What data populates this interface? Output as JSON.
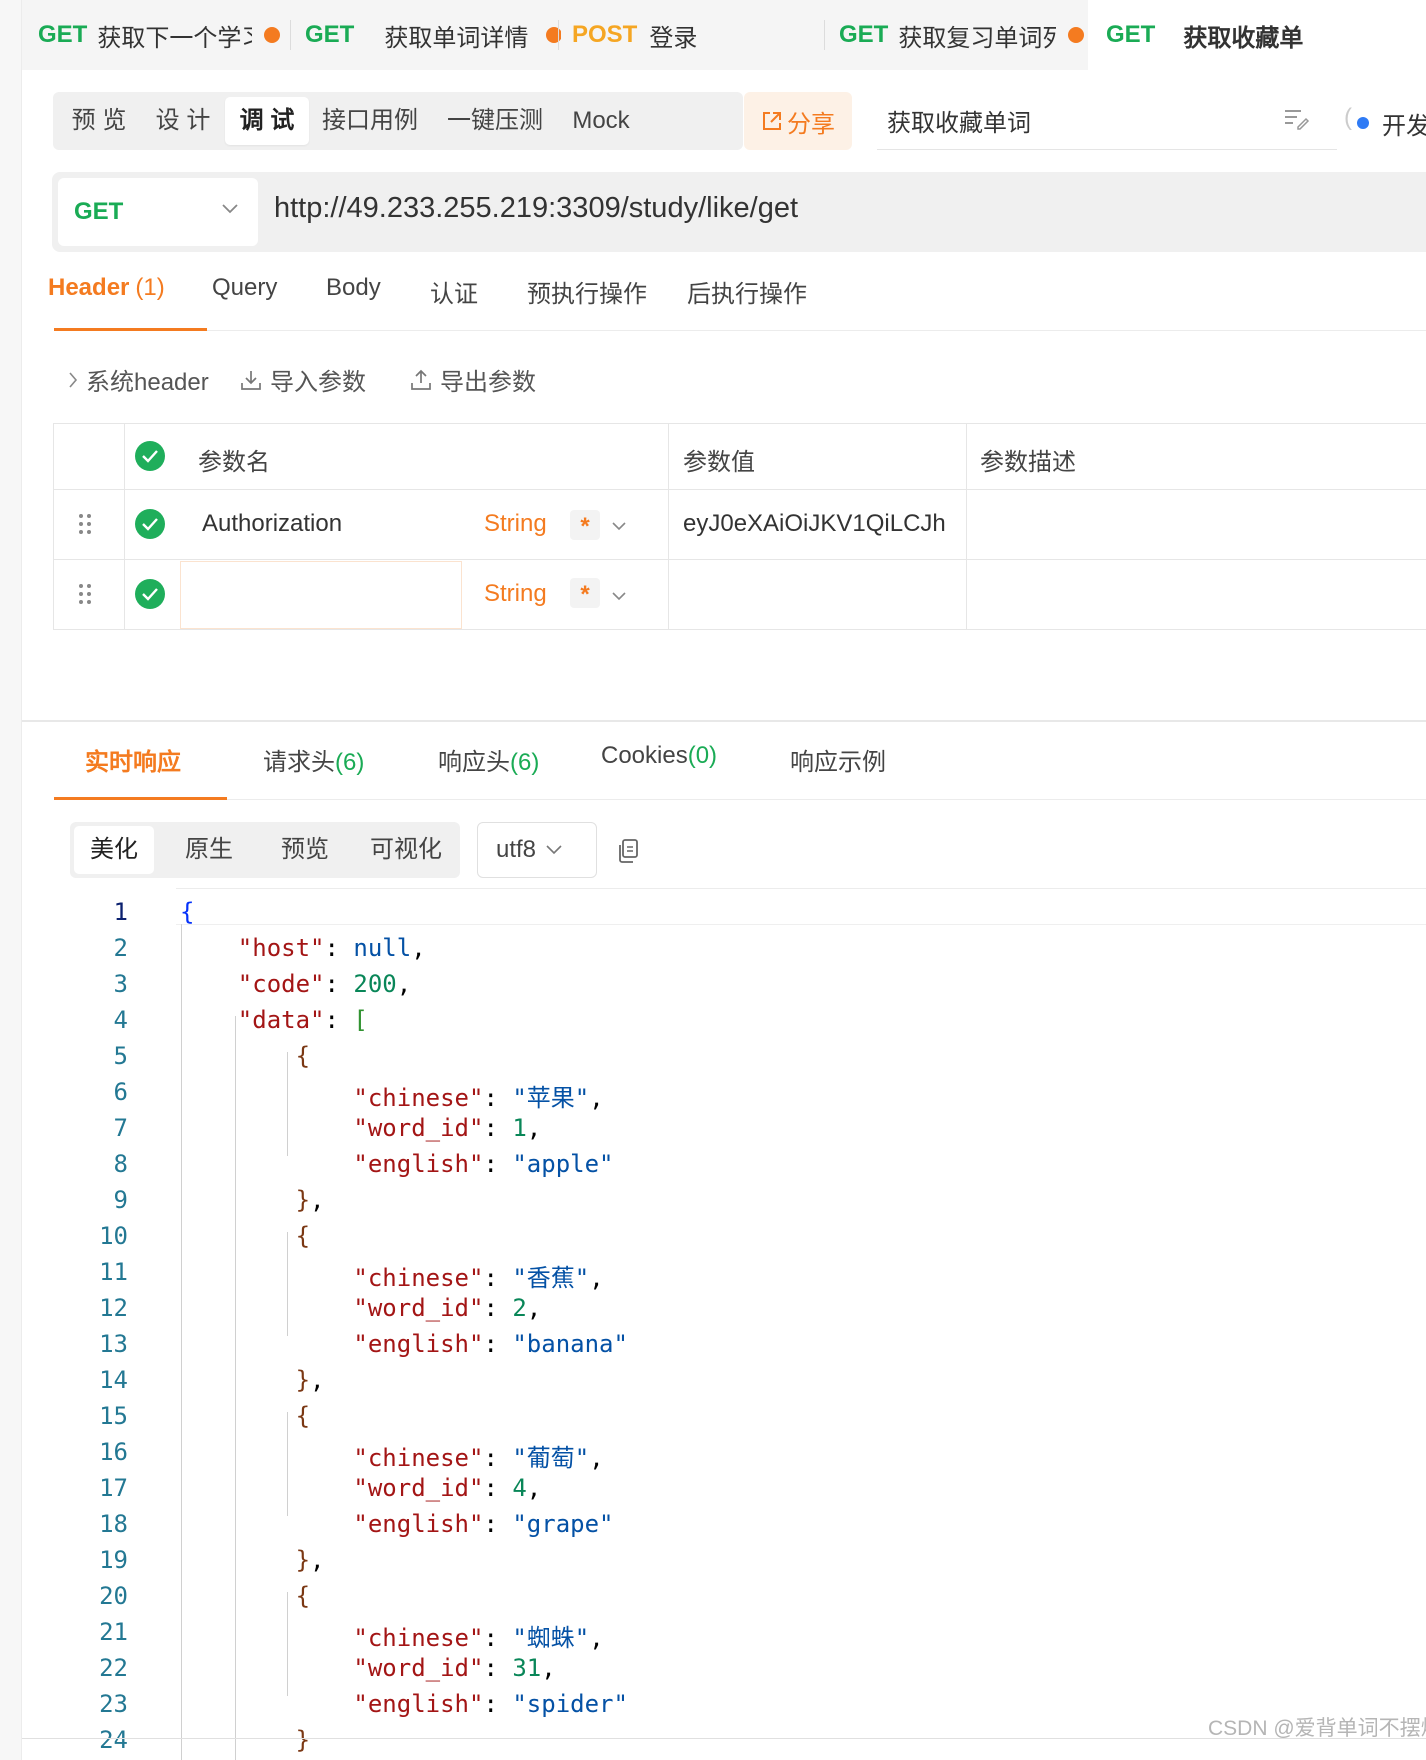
{
  "tabs": [
    {
      "method": "GET",
      "title": "获取下一个学习!",
      "modified": true
    },
    {
      "method": "GET",
      "title": "获取单词详情",
      "modified": true
    },
    {
      "method": "POST",
      "title": "登录",
      "modified": false
    },
    {
      "method": "GET",
      "title": "获取复习单词列:",
      "modified": true
    },
    {
      "method": "GET",
      "title": "获取收藏单",
      "modified": false
    }
  ],
  "modes": [
    "预 览",
    "设 计",
    "调 试",
    "接口用例",
    "一键压测",
    "Mock"
  ],
  "active_mode": "调 试",
  "share_label": "分享",
  "api_name": "获取收藏单词",
  "status_label": "开发中",
  "request": {
    "method": "GET",
    "url": "http://49.233.255.219:3309/study/like/get"
  },
  "request_tabs": [
    {
      "label": "Header",
      "count": "(1)"
    },
    {
      "label": "Query",
      "count": ""
    },
    {
      "label": "Body",
      "count": ""
    },
    {
      "label": "认证",
      "count": ""
    },
    {
      "label": "预执行操作",
      "count": ""
    },
    {
      "label": "后执行操作",
      "count": ""
    }
  ],
  "header_actions": {
    "system_header": "系统header",
    "import": "导入参数",
    "export": "导出参数"
  },
  "param_table": {
    "columns": {
      "name": "参数名",
      "value": "参数值",
      "desc": "参数描述"
    },
    "rows": [
      {
        "name": "Authorization",
        "type": "String",
        "required": "*",
        "value": "eyJ0eXAiOiJKV1QiLCJh",
        "desc": ""
      },
      {
        "name": "",
        "type": "String",
        "required": "*",
        "value": "",
        "desc": ""
      }
    ]
  },
  "response_tabs": [
    {
      "label": "实时响应",
      "count": ""
    },
    {
      "label": "请求头",
      "count": "(6)"
    },
    {
      "label": "响应头",
      "count": "(6)"
    },
    {
      "label": "Cookies",
      "count": "(0)"
    },
    {
      "label": "响应示例",
      "count": ""
    }
  ],
  "format_tabs": [
    "美化",
    "原生",
    "预览",
    "可视化"
  ],
  "active_format": "美化",
  "encoding": "utf8",
  "response_lines": [
    "1",
    "2",
    "3",
    "4",
    "5",
    "6",
    "7",
    "8",
    "9",
    "10",
    "11",
    "12",
    "13",
    "14",
    "15",
    "16",
    "17",
    "18",
    "19",
    "20",
    "21",
    "22",
    "23",
    "24"
  ],
  "response_json": {
    "host": "null",
    "code": "200",
    "data": [
      {
        "chinese": "苹果",
        "word_id": "1",
        "english": "apple"
      },
      {
        "chinese": "香蕉",
        "word_id": "2",
        "english": "banana"
      },
      {
        "chinese": "葡萄",
        "word_id": "4",
        "english": "grape"
      },
      {
        "chinese": "蜘蛛",
        "word_id": "31",
        "english": "spider"
      }
    ]
  },
  "watermark": "CSDN @爱背单词不摆烂",
  "colors": {
    "accent": "#f47b20",
    "get": "#1aab55",
    "post": "#f5a623",
    "check": "#1fae5b"
  }
}
